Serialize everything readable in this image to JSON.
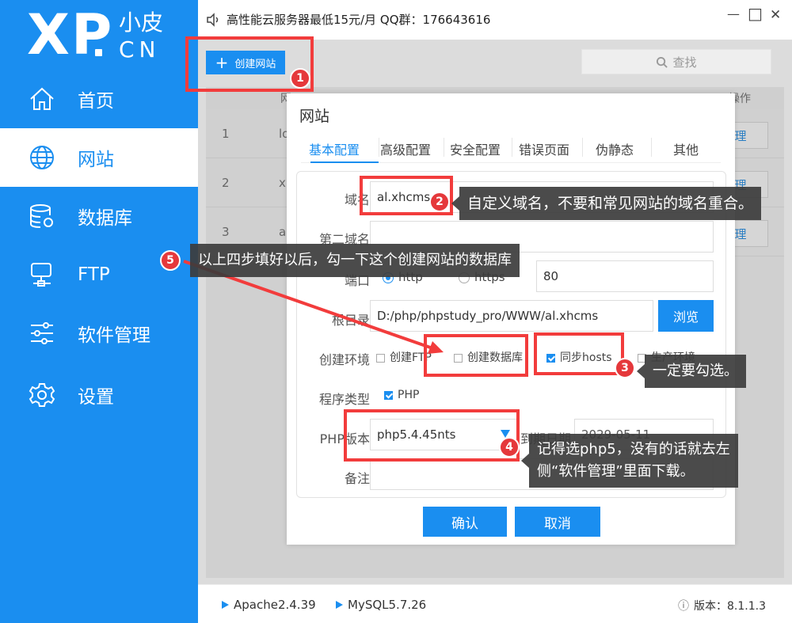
{
  "colors": {
    "accent": "#1a8ef0",
    "annotation_red": "#f23c3c",
    "callout_bg": "#3c3c3c"
  },
  "logo": {
    "main": "XP",
    "sub_cn": "小皮",
    "sub_en": "CN"
  },
  "sidebar": {
    "items": [
      {
        "label": "首页",
        "icon": "home-icon"
      },
      {
        "label": "网站",
        "icon": "globe-icon"
      },
      {
        "label": "数据库",
        "icon": "database-icon"
      },
      {
        "label": "FTP",
        "icon": "server-icon"
      },
      {
        "label": "软件管理",
        "icon": "sliders-icon"
      },
      {
        "label": "设置",
        "icon": "gear-icon"
      }
    ],
    "active": "网站"
  },
  "titlebar": {
    "notice": "高性能云服务器最低15元/月  QQ群：176643616",
    "min": "—",
    "max": "□",
    "close": "✕"
  },
  "toolbar": {
    "create_label": "创建网站",
    "create_icon": "+",
    "search_label": "查找"
  },
  "table": {
    "header_partial": [
      "网",
      "操作"
    ],
    "rows": [
      {
        "index": "1",
        "name": "lo",
        "action": "理"
      },
      {
        "index": "2",
        "name": "x",
        "action": "理"
      },
      {
        "index": "3",
        "name": "a",
        "action": "理"
      }
    ]
  },
  "dialog": {
    "title": "网站",
    "tabs": [
      "基本配置",
      "高级配置",
      "安全配置",
      "错误页面",
      "伪静态",
      "其他"
    ],
    "active_tab": "基本配置",
    "fields": {
      "domain_label": "域名",
      "domain_value": "al.xhcms",
      "second_domain_label": "第二域名",
      "second_domain_value": "",
      "port_label": "端口",
      "port_http": "http",
      "port_https": "https",
      "port_value": "80",
      "root_label": "根目录",
      "root_value": "D:/php/phpstudy_pro/WWW/al.xhcms",
      "browse_label": "浏览",
      "env_label": "创建环境",
      "env_opt_ftp": "创建FTP",
      "env_opt_db": "创建数据库",
      "env_opt_hosts": "同步hosts",
      "env_opt_prod": "生产环境",
      "prog_label": "程序类型",
      "prog_php": "PHP",
      "php_label": "PHP版本",
      "php_value": "php5.4.45nts",
      "expire_label": "到期日期",
      "expire_value": "2029-05-11",
      "note_label": "备注",
      "note_value": ""
    },
    "confirm_label": "确认",
    "cancel_label": "取消"
  },
  "footer": {
    "apache": "Apache2.4.39",
    "mysql": "MySQL5.7.26",
    "version": "版本：8.1.1.3",
    "info_icon": "ⓘ"
  },
  "annotations": {
    "badges": [
      "1",
      "2",
      "3",
      "4",
      "5"
    ],
    "c2": "自定义域名，不要和常见网站的域名重合。",
    "c3": "一定要勾选。",
    "c4_line1": "记得选php5，没有的话就去左",
    "c4_line2": "侧“软件管理”里面下载。",
    "c5": "以上四步填好以后，勾一下这个创建网站的数据库"
  }
}
